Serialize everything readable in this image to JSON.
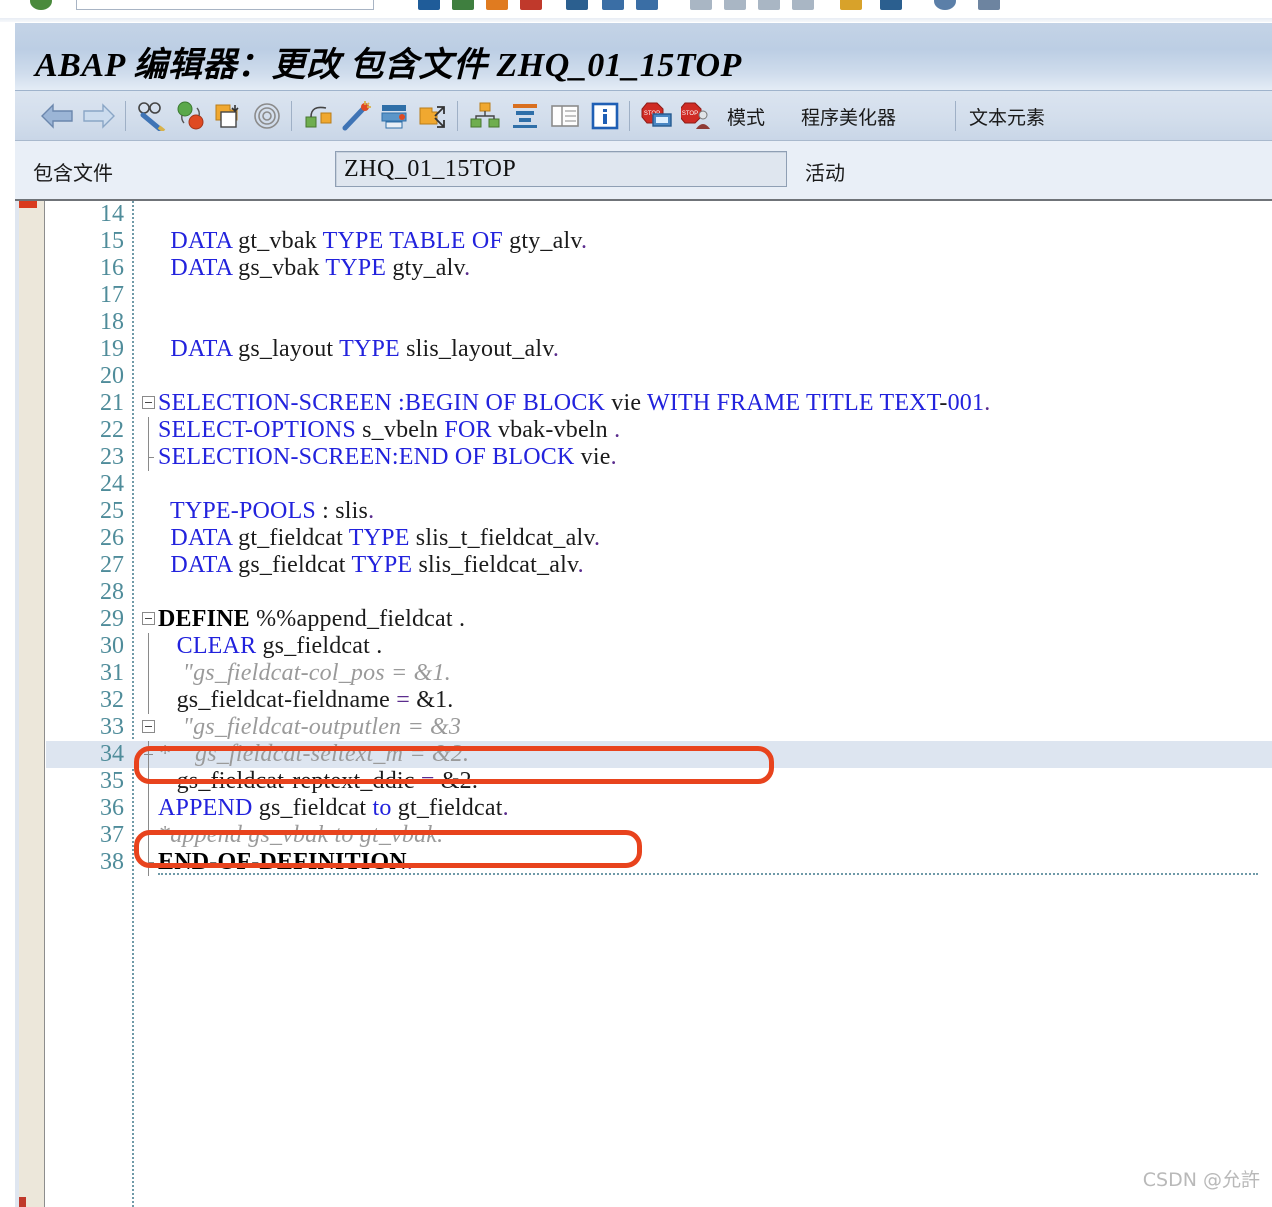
{
  "window": {
    "title": "ABAP 编辑器：更改 包含文件 ZHQ_01_15TOP"
  },
  "toolbar": {
    "icons": [
      {
        "name": "back-arrow-icon",
        "glyph": "⬅"
      },
      {
        "name": "forward-arrow-icon",
        "glyph": "➡"
      },
      {
        "name": "display-change-icon",
        "glyph": "✎"
      },
      {
        "name": "check-syntax-icon",
        "glyph": "●"
      },
      {
        "name": "activate-icon",
        "glyph": "▣"
      },
      {
        "name": "pattern-icon",
        "glyph": "◎"
      },
      {
        "name": "where-used-icon",
        "glyph": "⌘"
      },
      {
        "name": "pretty-printer-wand-icon",
        "glyph": "✦"
      },
      {
        "name": "print-icon",
        "glyph": "🖶"
      },
      {
        "name": "navigate-icon",
        "glyph": "➶"
      },
      {
        "name": "object-navigator-icon",
        "glyph": "⛁"
      },
      {
        "name": "sort-icon",
        "glyph": "☰"
      },
      {
        "name": "split-screen-icon",
        "glyph": "▤"
      },
      {
        "name": "information-icon",
        "glyph": "i"
      },
      {
        "name": "debug-stop-icon",
        "glyph": "🛑"
      },
      {
        "name": "breakpoint-user-icon",
        "glyph": "🛑"
      }
    ],
    "labels": {
      "mode": "模式",
      "pretty_printer": "程序美化器",
      "text_elements": "文本元素"
    }
  },
  "field_row": {
    "label": "包含文件",
    "value": "ZHQ_01_15TOP",
    "status": "活动"
  },
  "editor": {
    "lines": [
      {
        "no": "14",
        "tokens": []
      },
      {
        "no": "15",
        "tokens": [
          {
            "t": "  ",
            "c": "id"
          },
          {
            "t": "DATA",
            "c": "kw"
          },
          {
            "t": " gt_vbak ",
            "c": "id"
          },
          {
            "t": "TYPE",
            "c": "kw"
          },
          {
            "t": " ",
            "c": "id"
          },
          {
            "t": "TABLE",
            "c": "kw"
          },
          {
            "t": " ",
            "c": "id"
          },
          {
            "t": "OF",
            "c": "kw"
          },
          {
            "t": " gty_alv",
            "c": "id"
          },
          {
            "t": ".",
            "c": "op"
          }
        ]
      },
      {
        "no": "16",
        "tokens": [
          {
            "t": "  ",
            "c": "id"
          },
          {
            "t": "DATA",
            "c": "kw"
          },
          {
            "t": " gs_vbak ",
            "c": "id"
          },
          {
            "t": "TYPE",
            "c": "kw"
          },
          {
            "t": " gty_alv",
            "c": "id"
          },
          {
            "t": ".",
            "c": "op"
          }
        ]
      },
      {
        "no": "17",
        "tokens": []
      },
      {
        "no": "18",
        "tokens": []
      },
      {
        "no": "19",
        "tokens": [
          {
            "t": "  ",
            "c": "id"
          },
          {
            "t": "DATA",
            "c": "kw"
          },
          {
            "t": " gs_layout ",
            "c": "id"
          },
          {
            "t": "TYPE",
            "c": "kw"
          },
          {
            "t": " slis_layout_alv",
            "c": "id"
          },
          {
            "t": ".",
            "c": "op"
          }
        ]
      },
      {
        "no": "20",
        "tokens": []
      },
      {
        "no": "21",
        "tokens": [
          {
            "t": "SELECTION-SCREEN :BEGIN OF BLOCK",
            "c": "kw"
          },
          {
            "t": " vie ",
            "c": "id"
          },
          {
            "t": "WITH FRAME TITLE TEXT",
            "c": "kw"
          },
          {
            "t": "-",
            "c": "id"
          },
          {
            "t": "001",
            "c": "kw"
          },
          {
            "t": ".",
            "c": "op"
          }
        ]
      },
      {
        "no": "22",
        "tokens": [
          {
            "t": "SELECT-OPTIONS",
            "c": "kw"
          },
          {
            "t": " s_vbeln ",
            "c": "id"
          },
          {
            "t": "FOR",
            "c": "kw"
          },
          {
            "t": " vbak-vbeln ",
            "c": "id"
          },
          {
            "t": ".",
            "c": "op"
          }
        ]
      },
      {
        "no": "23",
        "tokens": [
          {
            "t": "SELECTION-SCREEN:END OF BLOCK",
            "c": "kw"
          },
          {
            "t": " vie",
            "c": "id"
          },
          {
            "t": ".",
            "c": "op"
          }
        ]
      },
      {
        "no": "24",
        "tokens": []
      },
      {
        "no": "25",
        "tokens": [
          {
            "t": "  ",
            "c": "id"
          },
          {
            "t": "TYPE-POOLS",
            "c": "kw"
          },
          {
            "t": " : slis",
            "c": "id"
          },
          {
            "t": ".",
            "c": "op"
          }
        ]
      },
      {
        "no": "26",
        "tokens": [
          {
            "t": "  ",
            "c": "id"
          },
          {
            "t": "DATA",
            "c": "kw"
          },
          {
            "t": " gt_fieldcat ",
            "c": "id"
          },
          {
            "t": "TYPE",
            "c": "kw"
          },
          {
            "t": " slis_t_fieldcat_alv",
            "c": "id"
          },
          {
            "t": ".",
            "c": "op"
          }
        ]
      },
      {
        "no": "27",
        "tokens": [
          {
            "t": "  ",
            "c": "id"
          },
          {
            "t": "DATA",
            "c": "kw"
          },
          {
            "t": " gs_fieldcat ",
            "c": "id"
          },
          {
            "t": "TYPE",
            "c": "kw"
          },
          {
            "t": " slis_fieldcat_alv",
            "c": "id"
          },
          {
            "t": ".",
            "c": "op"
          }
        ]
      },
      {
        "no": "28",
        "tokens": []
      },
      {
        "no": "29",
        "tokens": [
          {
            "t": "DEFINE",
            "c": "kwb"
          },
          {
            "t": " %%append_fieldcat ",
            "c": "id"
          },
          {
            "t": ".",
            "c": "id"
          }
        ]
      },
      {
        "no": "30",
        "tokens": [
          {
            "t": "   ",
            "c": "id"
          },
          {
            "t": "CLEAR",
            "c": "kw"
          },
          {
            "t": " gs_fieldcat ",
            "c": "id"
          },
          {
            "t": ".",
            "c": "id"
          }
        ]
      },
      {
        "no": "31",
        "tokens": [
          {
            "t": "    \"gs_fieldcat-col_pos = &1.",
            "c": "cm"
          }
        ]
      },
      {
        "no": "32",
        "tokens": [
          {
            "t": "   gs_fieldcat-fieldname ",
            "c": "id"
          },
          {
            "t": "=",
            "c": "op"
          },
          {
            "t": " &1.",
            "c": "id"
          }
        ]
      },
      {
        "no": "33",
        "tokens": [
          {
            "t": "    \"gs_fieldcat-outputlen = &3",
            "c": "cm"
          }
        ]
      },
      {
        "no": "34",
        "tokens": [
          {
            "t": "*    gs_fieldcat-seltext_m = &2.",
            "c": "cm"
          }
        ]
      },
      {
        "no": "35",
        "tokens": [
          {
            "t": "   gs_fieldcat-reptext_ddic ",
            "c": "id"
          },
          {
            "t": "=",
            "c": "op"
          },
          {
            "t": " &2.",
            "c": "id"
          }
        ]
      },
      {
        "no": "36",
        "tokens": [
          {
            "t": "APPEND",
            "c": "kw"
          },
          {
            "t": " gs_fieldcat ",
            "c": "id"
          },
          {
            "t": "to",
            "c": "kw"
          },
          {
            "t": " gt_fieldcat",
            "c": "id"
          },
          {
            "t": ".",
            "c": "op"
          }
        ]
      },
      {
        "no": "37",
        "tokens": [
          {
            "t": "*append gs_vbak to gt_vbak.",
            "c": "cm"
          }
        ]
      },
      {
        "no": "38",
        "tokens": [
          {
            "t": "END-OF-DEFINITION",
            "c": "kwb"
          },
          {
            "t": ".",
            "c": "op"
          }
        ]
      }
    ],
    "highlighted_line": "34",
    "annotations": [
      {
        "name": "annotation-box-line-34",
        "target_line": "34"
      },
      {
        "name": "annotation-box-line-37",
        "target_line": "37"
      }
    ]
  },
  "watermark": {
    "text": "CSDN @允許"
  },
  "colors": {
    "keyword": "#2222dd",
    "comment": "#9a9a9a",
    "line_number": "#4f8c9a",
    "annotation": "#e8431d",
    "current_line_highlight": "#dde5f0",
    "title_bar": "#bccee4"
  }
}
